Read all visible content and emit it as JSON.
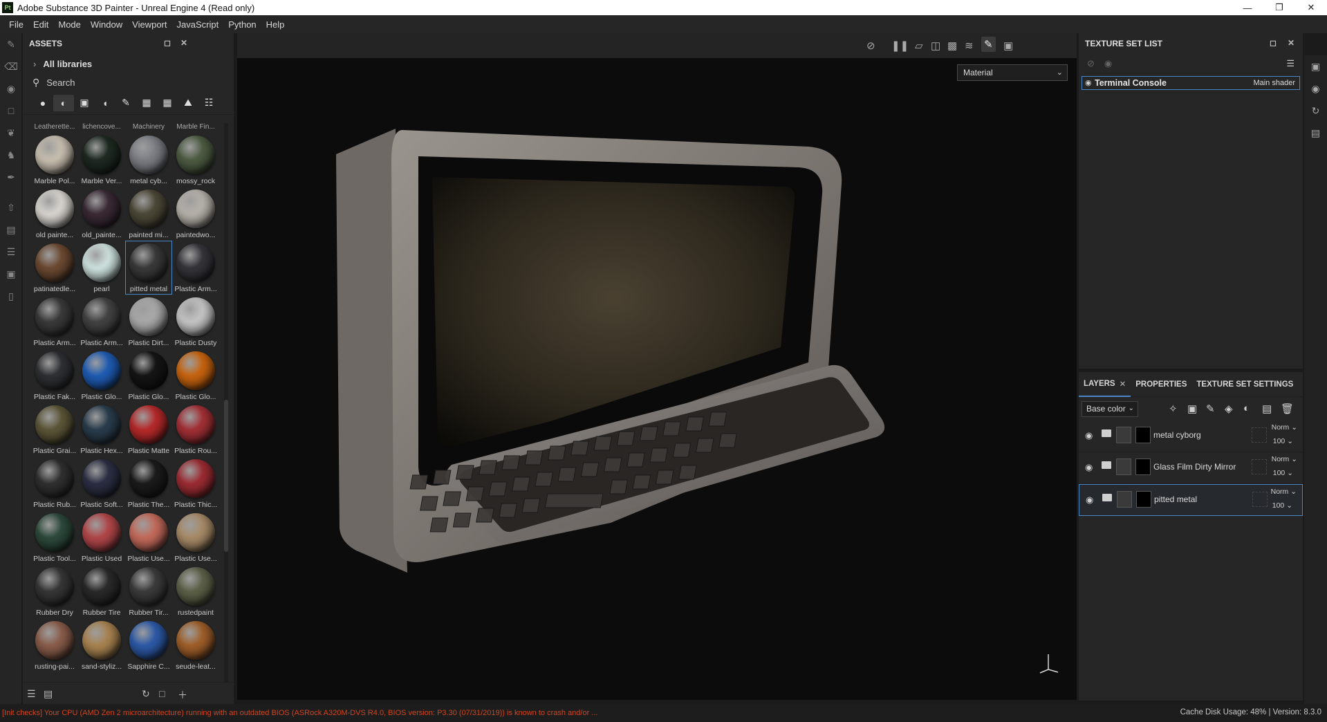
{
  "window": {
    "title": "Adobe Substance 3D Painter - Unreal Engine 4 (Read only)",
    "app_badge": "Pt"
  },
  "menu": [
    "File",
    "Edit",
    "Mode",
    "Window",
    "Viewport",
    "JavaScript",
    "Python",
    "Help"
  ],
  "assets": {
    "title": "ASSETS",
    "libraries": "All libraries",
    "search_placeholder": "Search",
    "cut_labels": [
      "Leatherette...",
      "lichencove...",
      "Machinery",
      "Marble Fin..."
    ],
    "items": [
      {
        "label": "Marble Pol...",
        "color": "#c8bfb0"
      },
      {
        "label": "Marble Ver...",
        "color": "#1e2a22"
      },
      {
        "label": "metal cyb...",
        "color": "#7d7f86"
      },
      {
        "label": "mossy_rock",
        "color": "#4e5c43"
      },
      {
        "label": "old painte...",
        "color": "#d9d6d0"
      },
      {
        "label": "old_painte...",
        "color": "#3a2a35"
      },
      {
        "label": "painted mi...",
        "color": "#4d4938"
      },
      {
        "label": "paintedwo...",
        "color": "#b7b2ab"
      },
      {
        "label": "patinatedle...",
        "color": "#6d4a32"
      },
      {
        "label": "pearl",
        "color": "#cfe3df"
      },
      {
        "label": "pitted metal",
        "color": "#3a3a3a"
      },
      {
        "label": "Plastic Arm...",
        "color": "#34343a"
      },
      {
        "label": "Plastic Arm...",
        "color": "#3a3a3a"
      },
      {
        "label": "Plastic Arm...",
        "color": "#434343"
      },
      {
        "label": "Plastic Dirt...",
        "color": "#a9a9a9"
      },
      {
        "label": "Plastic Dusty",
        "color": "#c5c5c5"
      },
      {
        "label": "Plastic Fak...",
        "color": "#2f3033"
      },
      {
        "label": "Plastic Glo...",
        "color": "#1f5cb3"
      },
      {
        "label": "Plastic Glo...",
        "color": "#151515"
      },
      {
        "label": "Plastic Glo...",
        "color": "#c8640f"
      },
      {
        "label": "Plastic Grai...",
        "color": "#5c5638"
      },
      {
        "label": "Plastic Hex...",
        "color": "#2a3d4d"
      },
      {
        "label": "Plastic Matte",
        "color": "#b72a2a"
      },
      {
        "label": "Plastic Rou...",
        "color": "#a33036"
      },
      {
        "label": "Plastic Rub...",
        "color": "#303030"
      },
      {
        "label": "Plastic Soft...",
        "color": "#2c2f44"
      },
      {
        "label": "Plastic The...",
        "color": "#1b1b1b"
      },
      {
        "label": "Plastic Thic...",
        "color": "#9c2c33"
      },
      {
        "label": "Plastic Tool...",
        "color": "#2d4a3c"
      },
      {
        "label": "Plastic Used",
        "color": "#b2474a"
      },
      {
        "label": "Plastic Use...",
        "color": "#c46a5a"
      },
      {
        "label": "Plastic Use...",
        "color": "#a88b68"
      },
      {
        "label": "Rubber Dry",
        "color": "#363636"
      },
      {
        "label": "Rubber Tire",
        "color": "#2a2a2a"
      },
      {
        "label": "Rubber Tir...",
        "color": "#3b3b3b"
      },
      {
        "label": "rustedpaint",
        "color": "#5d6148"
      },
      {
        "label": "rusting-pai...",
        "color": "#8a5d4b"
      },
      {
        "label": "sand-styliz...",
        "color": "#a88350"
      },
      {
        "label": "Sapphire C...",
        "color": "#2d5aa8"
      },
      {
        "label": "seude-leat...",
        "color": "#a05f2a"
      }
    ]
  },
  "viewport": {
    "material_mode": "Material"
  },
  "texture_set_list": {
    "title": "TEXTURE SET LIST",
    "item_name": "Terminal Console",
    "item_shader": "Main shader"
  },
  "layers_panel": {
    "tabs": [
      "LAYERS",
      "PROPERTIES",
      "TEXTURE SET SETTINGS"
    ],
    "channel": "Base color",
    "layers": [
      {
        "name": "metal cyborg",
        "blend": "Norm",
        "opacity": "100"
      },
      {
        "name": "Glass Film Dirty Mirror",
        "blend": "Norm",
        "opacity": "100"
      },
      {
        "name": "pitted metal",
        "blend": "Norm",
        "opacity": "100"
      }
    ]
  },
  "status": {
    "message": "[Init checks] Your CPU (AMD Zen 2 microarchitecture) running with an outdated BIOS (ASRock A320M-DVS R4.0, BIOS version: P3.30 (07/31/2019)) is known to crash and/or ...",
    "cache_label": "Cache Disk Usage:",
    "cache_value": "48%",
    "version": "Version: 8.3.0"
  },
  "colors": {
    "accent": "#4a88c7",
    "warning": "#d0451f"
  }
}
